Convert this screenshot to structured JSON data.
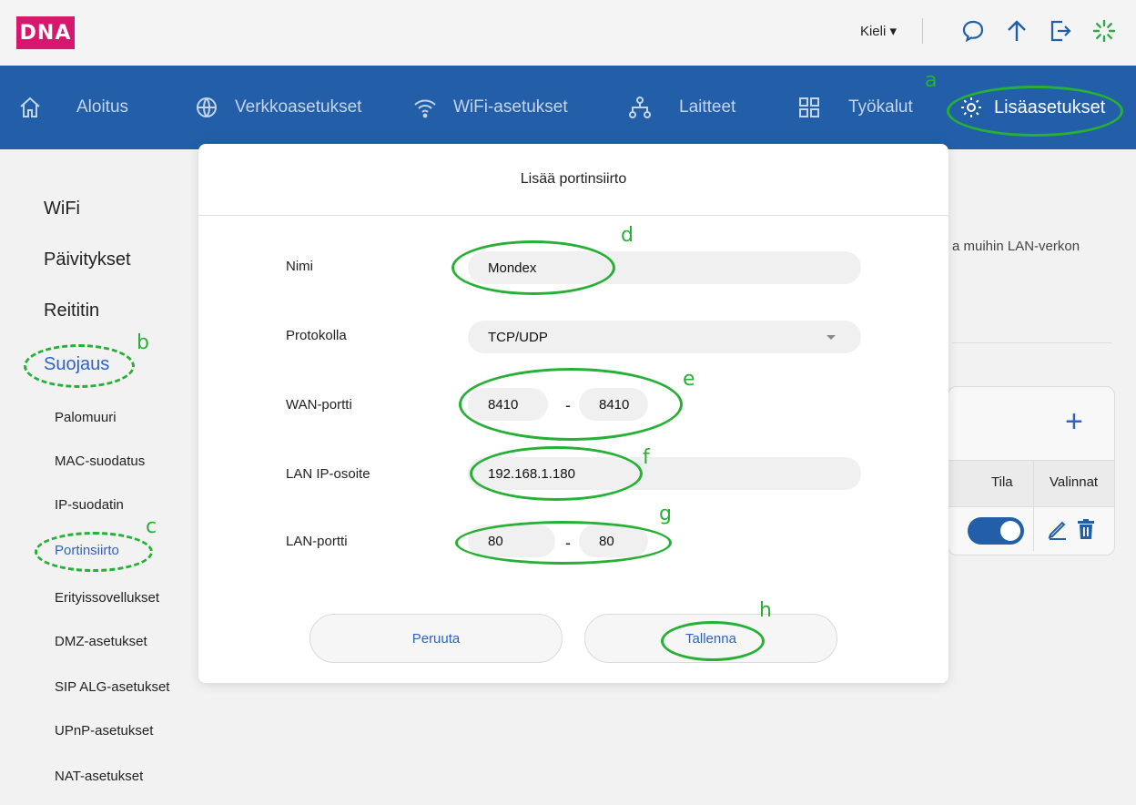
{
  "brand": {
    "logo_text": "DNA",
    "logo_color": "#d6176d"
  },
  "topbar": {
    "language": "Kieli ▾"
  },
  "icons": {
    "chat": "chat-bubble-icon",
    "upload": "arrow-up-icon",
    "logout": "logout-icon",
    "loading": "spinner-icon"
  },
  "nav": {
    "items": [
      {
        "label": "Aloitus",
        "icon": "home-icon"
      },
      {
        "label": "Verkkoasetukset",
        "icon": "globe-icon"
      },
      {
        "label": "WiFi-asetukset",
        "icon": "wifi-icon"
      },
      {
        "label": "Laitteet",
        "icon": "devices-icon"
      },
      {
        "label": "Työkalut",
        "icon": "grid-icon"
      },
      {
        "label": "Lisäasetukset",
        "icon": "gear-icon",
        "active": true
      }
    ],
    "color": "#225fa8"
  },
  "sidebar": {
    "sections": [
      "WiFi",
      "Päivitykset",
      "Reititin",
      "Suojaus"
    ],
    "active_section": "Suojaus",
    "subitems": [
      "Palomuuri",
      "MAC-suodatus",
      "IP-suodatin",
      "Portinsiirto",
      "Erityissovellukset",
      "DMZ-asetukset",
      "SIP ALG-asetukset",
      "UPnP-asetukset",
      "NAT-asetukset"
    ],
    "active_subitem": "Portinsiirto",
    "accent_color": "#2f62c6"
  },
  "background_page": {
    "description_fragment": "a muihin LAN-verkon",
    "table_columns": [
      "Tila",
      "Valinnat"
    ],
    "rule_enabled": true
  },
  "modal": {
    "title": "Lisää portinsiirto",
    "fields": {
      "name": {
        "label": "Nimi",
        "value": "Mondex"
      },
      "protocol": {
        "label": "Protokolla",
        "value": "TCP/UDP"
      },
      "wan_port": {
        "label": "WAN-portti",
        "from": "8410",
        "to": "8410"
      },
      "lan_ip": {
        "label": "LAN IP-osoite",
        "value": "192.168.1.180"
      },
      "lan_port": {
        "label": "LAN-portti",
        "from": "80",
        "to": "80"
      }
    },
    "range_separator": "-",
    "cancel_label": "Peruuta",
    "save_label": "Tallenna"
  },
  "annotations": {
    "color": "#26b036",
    "letters": [
      "a",
      "b",
      "c",
      "d",
      "e",
      "f",
      "g",
      "h"
    ]
  }
}
